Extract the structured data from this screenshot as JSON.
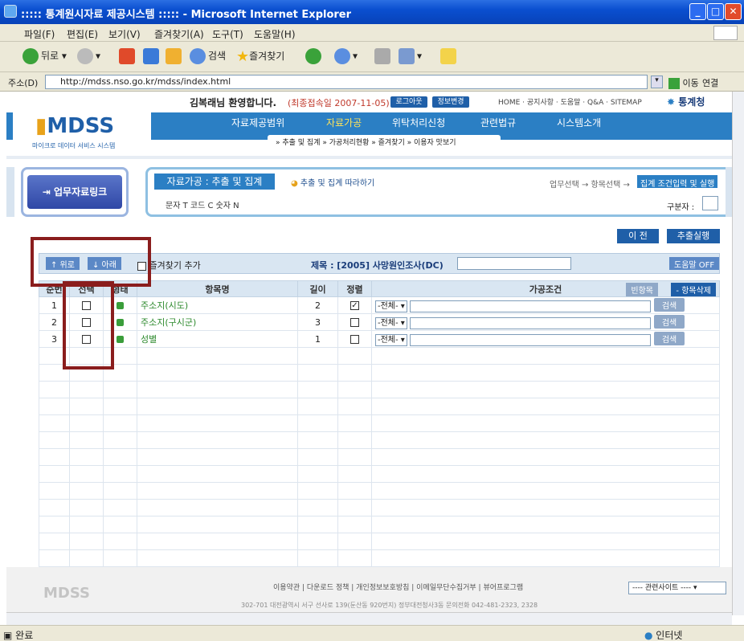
{
  "window": {
    "title": "::::: 통계원시자료 제공시스템 ::::: - Microsoft Internet Explorer"
  },
  "menu": [
    "파일(F)",
    "편집(E)",
    "보기(V)",
    "즐겨찾기(A)",
    "도구(T)",
    "도움말(H)"
  ],
  "toolbar": {
    "back": "뒤로",
    "search": "검색",
    "favorites": "즐겨찾기"
  },
  "address": {
    "label": "주소(D)",
    "url": "http://mdss.nso.go.kr/mdss/index.html",
    "go": "이동",
    "links": "연결"
  },
  "header": {
    "greeting": "김복래님 환영합니다.",
    "last_login": "(최종접속일 2007-11-05)",
    "logout": "로그아웃",
    "info": "정보변경",
    "toplinks": "HOME · 공지사항 · 도움말 · Q&A · SITEMAP",
    "agency": "통계청",
    "logo": "MDSS",
    "logo_sub": "마이크로 데이터 서비스 시스템"
  },
  "nav": {
    "items": [
      "자료제공범위",
      "자료가공",
      "위탁처리신청",
      "관련법규",
      "시스템소개"
    ],
    "sub": "» 추출 및 집계  » 가공처리현황  » 즐겨찾기  » 이용자 맛보기"
  },
  "leftpanel": {
    "label": "업무자료링크"
  },
  "process": {
    "tab": "자료가공 : 추출 및 집계",
    "follow": "추출 및 집계 따라하기",
    "steps": "업무선택 → 항목선택 →",
    "current": "집계 조건입력 및 실행",
    "types": "문자 T  코드 C  숫자 N",
    "delim_label": "구분자 :"
  },
  "actions": {
    "prev": "이 전",
    "run": "추출실행"
  },
  "control": {
    "up": "↑ 위로",
    "down": "↓ 아래",
    "favorite": "즐겨찾기 추가",
    "title_label": "제목 : [2005] 사망원인조사(DC)",
    "help_off": "도움말 OFF"
  },
  "table": {
    "headers": [
      "순번",
      "선택",
      "형태",
      "항목명",
      "길이",
      "정렬",
      "가공조건"
    ],
    "empty_btn": "빈항목",
    "del_btn": "- 항목삭제",
    "rows": [
      {
        "no": "1",
        "name": "주소지(시도)",
        "len": "2",
        "sorted": true,
        "cond": "-전체-",
        "btn": "검색"
      },
      {
        "no": "2",
        "name": "주소지(구시군)",
        "len": "3",
        "sorted": false,
        "cond": "-전체-",
        "btn": "검색"
      },
      {
        "no": "3",
        "name": "성별",
        "len": "1",
        "sorted": false,
        "cond": "-전체-",
        "btn": "검색"
      }
    ]
  },
  "footer": {
    "links": "이용약관 | 다운로드 정책 | 개인정보보호방침 | 이메일무단수집거부 | 뷰어프로그램",
    "address": "302-701 대전광역시 서구 선사로 139(둔산동 920번지) 정부대전청사3동  문의전화 042-481-2323, 2328",
    "related": "---- 관련사이트 ----",
    "logo": "MDSS"
  },
  "status": {
    "left": "완료",
    "zone": "인터넷"
  }
}
